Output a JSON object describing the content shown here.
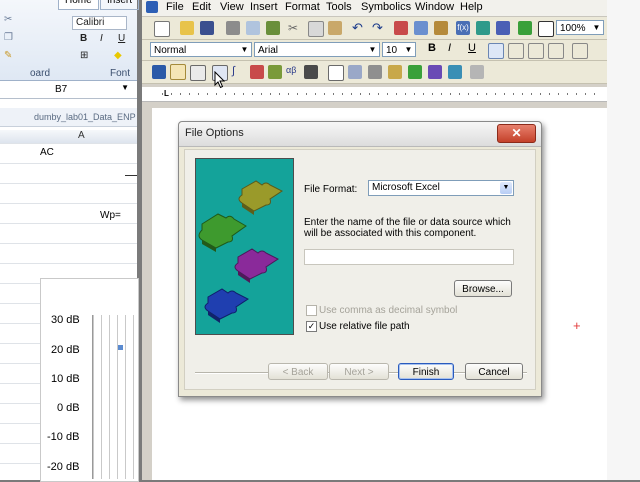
{
  "excel": {
    "tab_home": "Home",
    "tab_insert": "Insert",
    "font_name": "Calibri",
    "group_clipboard": "oard",
    "group_font": "Font",
    "name_box": "B7",
    "file_title": "dumby_lab01_Data_ENP",
    "col_a": "A",
    "cell_ac": "AC",
    "cell_wp": "Wp=",
    "chart_labels": [
      "30 dB",
      "20 dB",
      "10 dB",
      "0 dB",
      "-10 dB",
      "-20 dB"
    ]
  },
  "word": {
    "menu": [
      "File",
      "Edit",
      "View",
      "Insert",
      "Format",
      "Tools",
      "Symbolics",
      "Window",
      "Help"
    ],
    "style_combo": "Normal",
    "font_combo": "Arial",
    "size_combo": "10",
    "zoom_combo": "100%",
    "bold": "B",
    "italic": "I",
    "underline": "U"
  },
  "dialog": {
    "title": "File Options",
    "file_format_label": "File Format:",
    "file_format_value": "Microsoft Excel",
    "instructions": "Enter the name of the file or data source which will be associated with this component.",
    "source_value": "",
    "browse_label": "Browse...",
    "use_comma_label": "Use comma as decimal symbol",
    "use_comma_checked": false,
    "use_relative_label": "Use relative file path",
    "use_relative_checked": true,
    "back_label": "< Back",
    "next_label": "Next >",
    "finish_label": "Finish",
    "cancel_label": "Cancel"
  },
  "colors": {
    "art_bg": "#14a39a",
    "puzzle_olive": "#9a9a2a",
    "puzzle_green": "#3e9a2e",
    "puzzle_purple": "#8a2a9a",
    "puzzle_blue": "#1f3fb0",
    "close_red": "#c4412a"
  }
}
